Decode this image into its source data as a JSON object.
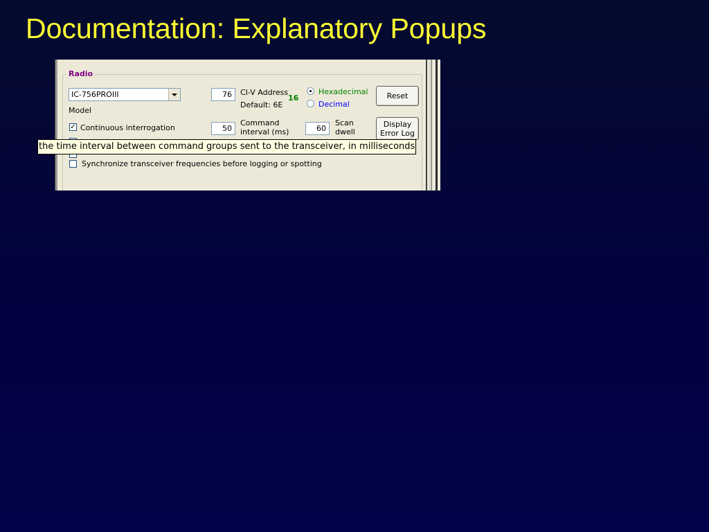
{
  "slide": {
    "title": "Documentation: Explanatory Popups"
  },
  "radio_panel": {
    "group_label": "Radio",
    "model_select": {
      "value": "IC-756PROIII"
    },
    "model_label": "Model",
    "civ_address": {
      "value": "76",
      "label": "CI-V Address",
      "default_text": "Default: 6E",
      "decimal_readout": "16"
    },
    "radix": {
      "hex_label": "Hexadecimal",
      "dec_label": "Decimal",
      "selected": "Hexadecimal",
      "hex_color": "#008000",
      "dec_color": "#0000ff"
    },
    "reset_button": "Reset",
    "continuous_interrogation": {
      "label": "Continuous interrogation",
      "checked": true
    },
    "command_interval": {
      "value": "50",
      "label_line1": "Command",
      "label_line2": "interval (ms)"
    },
    "scan_dwell": {
      "value": "60",
      "label_line1": "Scan",
      "label_line2": "dwell"
    },
    "display_error_log_button": {
      "line1": "Display",
      "line2": "Error Log"
    },
    "synchronize": {
      "label": "Synchronize transceiver frequencies before logging or spotting",
      "checked": false
    }
  },
  "tooltip": {
    "text": "the time interval between command groups sent to the transceiver, in milliseconds"
  }
}
